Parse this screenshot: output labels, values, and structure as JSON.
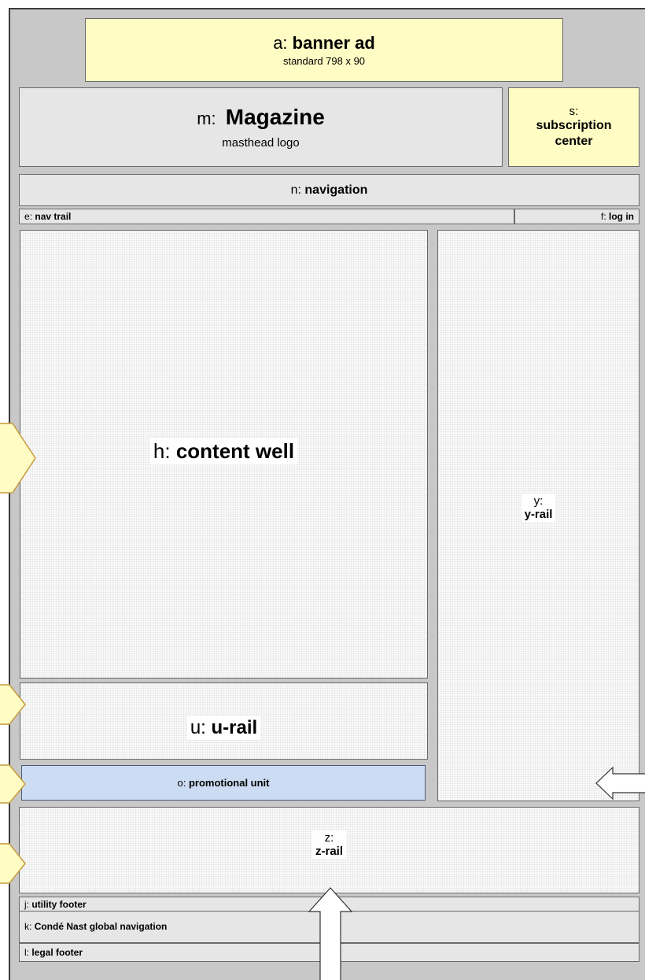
{
  "banner": {
    "prefix": "a:",
    "title": "banner ad",
    "subtitle": "standard 798 x 90"
  },
  "masthead": {
    "prefix": "m:",
    "title": "Magazine",
    "subtitle": "masthead logo"
  },
  "subscription": {
    "prefix": "s:",
    "line1": "subscription",
    "line2": "center"
  },
  "navigation": {
    "prefix": "n:",
    "title": "navigation"
  },
  "nav_trail": {
    "prefix": "e:",
    "title": "nav trail"
  },
  "log_in": {
    "prefix": "f:",
    "title": "log in"
  },
  "content_well": {
    "prefix": "h:",
    "title": "content well"
  },
  "y_rail": {
    "prefix": "y:",
    "title": "y-rail"
  },
  "u_rail": {
    "prefix": "u:",
    "title": "u-rail"
  },
  "promo": {
    "prefix": "o:",
    "title": "promotional unit"
  },
  "z_rail": {
    "prefix": "z:",
    "title": "z-rail"
  },
  "utility_footer": {
    "prefix": "j:",
    "title": "utility footer"
  },
  "global_nav": {
    "prefix": "k:",
    "title": "Condé Nast global navigation"
  },
  "legal_footer": {
    "prefix": "l:",
    "title": "legal footer"
  },
  "colors": {
    "background": "#c8c8c8",
    "ad_yellow": "#fffcc4",
    "promo_blue": "#ccdcf3",
    "panel_gray": "#e6e6e6"
  }
}
